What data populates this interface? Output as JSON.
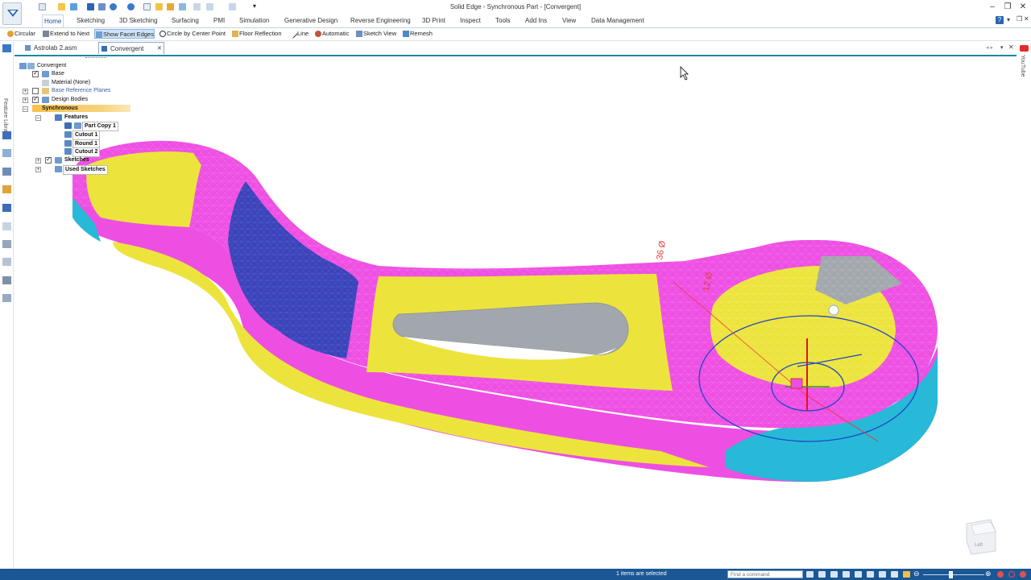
{
  "window": {
    "title": "Solid Edge - Synchronous Part - [Convergent]",
    "minimize": "–",
    "restore": "❐",
    "close": "✕"
  },
  "ribbon": {
    "tabs": [
      "Home",
      "Sketching",
      "3D Sketching",
      "Surfacing",
      "PMI",
      "Simulation",
      "Generative Design",
      "Reverse Engineering",
      "3D Print",
      "Inspect",
      "Tools",
      "Add Ins",
      "View",
      "Data Management"
    ],
    "active_tab": "Home",
    "help": "?"
  },
  "commands": {
    "circular": "Circular",
    "extend_to_next": "Extend to Next",
    "show_facet_edges": "Show Facet Edges",
    "circle_by_center_point": "Circle by Center Point",
    "floor_reflection": "Floor Reflection",
    "line": "Line",
    "automatic": "Automatic",
    "sketch_view": "Sketch View",
    "remesh": "Remesh"
  },
  "documents": {
    "tabs": [
      "Astrolab 2.asm",
      "Convergent"
    ],
    "active": "Convergent",
    "close": "✕"
  },
  "sidebar": {
    "feature_library": "Feature Library",
    "youtube": "YouTube"
  },
  "tree": {
    "root": "Convergent",
    "base": "Base",
    "material": "Material (None)",
    "base_reference_planes": "Base Reference Planes",
    "design_bodies": "Design Bodies",
    "synchronous": "Synchronous",
    "features": "Features",
    "part_copy": "Part Copy 1",
    "cutout1": "Cutout 1",
    "round1": "Round 1",
    "cutout2": "Cutout 2",
    "sketches": "Sketches",
    "used_sketches": "Used Sketches"
  },
  "dimensions": {
    "d36": "36 Ø",
    "d12": "12 Ø"
  },
  "viewcube": {
    "face": "Left"
  },
  "status": {
    "selection": "1 items are selected",
    "find_placeholder": "Find a command"
  },
  "colors": {
    "magenta": "#ee4fe3",
    "yellow": "#ece43c",
    "blue": "#3a43b8",
    "cyan": "#27b9d7",
    "gray": "#a2a7ad",
    "statusbar": "#1a5794",
    "accent": "#1b8a9c"
  }
}
